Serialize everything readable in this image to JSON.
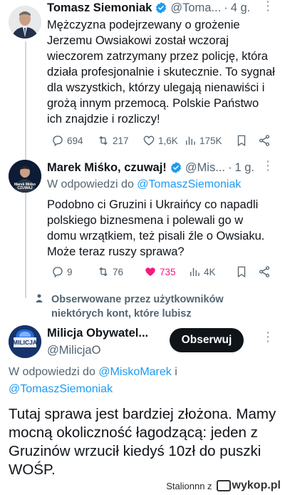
{
  "tweet1": {
    "name": "Tomasz Siemoniak",
    "handle": "@Toma...",
    "time": "4 g.",
    "text": "Mężczyzna podejrzewany o grożenie Jerzemu Owsiakowi został wczoraj wieczorem zatrzymany przez policję, która działa profesjonalnie i skutecznie. To sygnał dla wszystkich, którzy ulegają nienawiści i grożą innym przemocą. Polskie Państwo ich znajdzie i rozliczy!",
    "replies": "694",
    "retweets": "217",
    "likes": "1,6K",
    "views": "175K"
  },
  "tweet2": {
    "name": "Marek Miśko, czuwaj!",
    "handle": "@Mis...",
    "time": "1 g.",
    "reply_prefix": "W odpowiedzi do ",
    "reply_to": "@TomaszSiemoniak",
    "text": "Podobno ci Gruzini i Ukraińcy co napadli polskiego biznesmena i polewali go w domu wrzątkiem, też pisali źle o Owsiaku. Może teraz ruszy sprawa?",
    "avatar_caption": "Marek Miśko CZUWAJ",
    "replies": "9",
    "retweets": "76",
    "likes": "735",
    "views": "4K"
  },
  "social_context": "Obserwowane przez użytkowników niektórych kont, które lubisz",
  "tweet3": {
    "name": "Milicja Obywatel...",
    "handle": "@MilicjaO",
    "follow_label": "Obserwuj",
    "avatar_label": "MILICJA",
    "reply_prefix": "W odpowiedzi do ",
    "reply_to_1": "@MiskoMarek",
    "reply_and": " i",
    "reply_to_2": "@TomaszSiemoniak",
    "text": "Tutaj sprawa jest bardziej złożona. Mamy mocną okoliczność łagodzącą: jeden z Gruzinów wrzucił kiedyś 10zł do puszki WOŚP."
  },
  "watermark": {
    "user": "Stalionnn z",
    "site": "wykop.pl"
  },
  "colors": {
    "accent": "#1d9bf0",
    "like": "#f91880",
    "muted": "#536471"
  }
}
